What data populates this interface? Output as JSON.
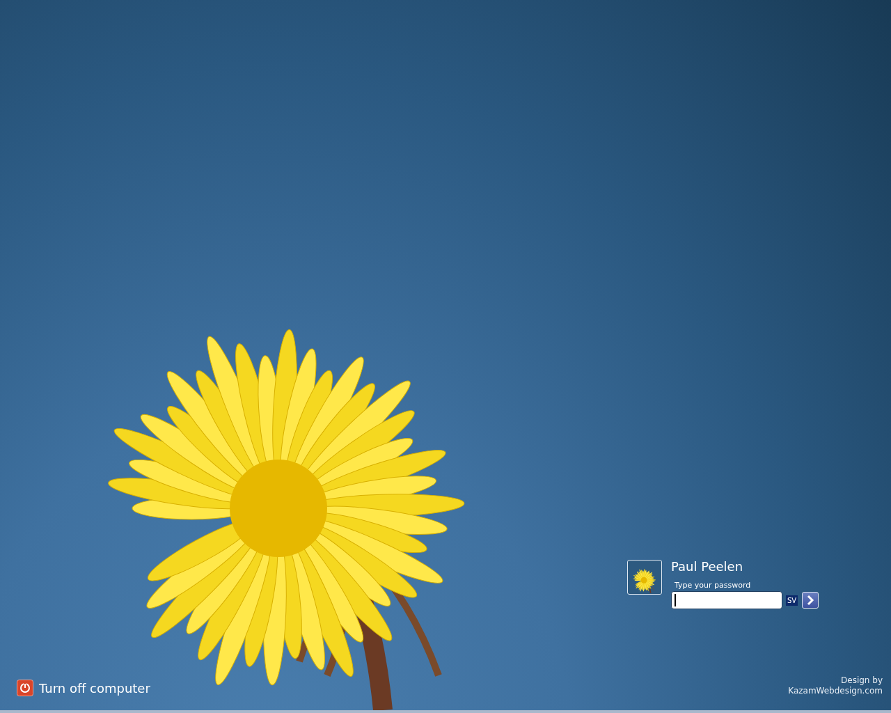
{
  "user": {
    "name": "Paul Peelen"
  },
  "password": {
    "label": "Type your password"
  },
  "keyboard_layout": "SV",
  "shutdown": {
    "label": "Turn off computer"
  },
  "credit": {
    "line_1": "Design by",
    "line_2": "KazamWebdesign.com"
  }
}
